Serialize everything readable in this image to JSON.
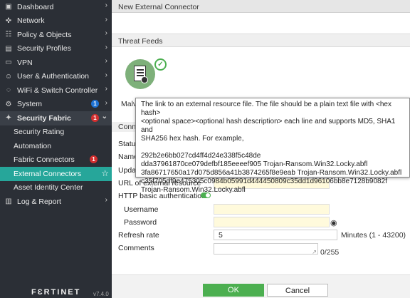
{
  "sidebar": {
    "items": [
      {
        "label": "Dashboard",
        "icon": "dashboard-icon",
        "glyph": "▣"
      },
      {
        "label": "Network",
        "icon": "network-icon",
        "glyph": "✜"
      },
      {
        "label": "Policy & Objects",
        "icon": "policy-icon",
        "glyph": "☷"
      },
      {
        "label": "Security Profiles",
        "icon": "lock-icon",
        "glyph": "▤"
      },
      {
        "label": "VPN",
        "icon": "vpn-icon",
        "glyph": "▭"
      },
      {
        "label": "User & Authentication",
        "icon": "user-icon",
        "glyph": "☺"
      },
      {
        "label": "WiFi & Switch Controller",
        "icon": "wifi-icon",
        "glyph": "◌"
      },
      {
        "label": "System",
        "icon": "gear-icon",
        "glyph": "⚙",
        "badge": "1"
      },
      {
        "label": "Security Fabric",
        "icon": "fabric-icon",
        "glyph": "✦",
        "badge": "1"
      }
    ],
    "subitems": [
      {
        "label": "Security Rating"
      },
      {
        "label": "Automation"
      },
      {
        "label": "Fabric Connectors",
        "badge": "1"
      },
      {
        "label": "External Connectors"
      },
      {
        "label": "Asset Identity Center"
      }
    ],
    "log": {
      "label": "Log & Report",
      "icon": "chart-icon",
      "glyph": "▥"
    },
    "brand": "FԐRTINET",
    "version": "v7.4.0"
  },
  "main": {
    "title": "New External Connector",
    "section": "Threat Feeds",
    "partial_malw": "Malv",
    "partial_conn": "Conne",
    "partial_status": "Status",
    "partial_name": "Name",
    "partial_update": "Updat",
    "form": {
      "url_label": "URL of external resource",
      "http_auth_label": "HTTP basic authentication",
      "username_label": "Username",
      "password_label": "Password",
      "refresh_label": "Refresh rate",
      "refresh_value": "5",
      "refresh_hint": "Minutes (1 - 43200)",
      "comments_label": "Comments",
      "comments_count": "0/255"
    },
    "buttons": {
      "ok": "OK",
      "cancel": "Cancel"
    }
  },
  "tooltip": {
    "line1": "The link to an external resource file. The file should be a plain text file with <hex hash>",
    "line2": "<optional space><optional hash description> each line and supports MD5, SHA1 and",
    "line3": "SHA256 hex hash. For example,",
    "ex1": "292b2e6bb027cd4ff4d24e338f5c48de",
    "ex2": "dda37961870ce079defbf185eeeef905 Trojan-Ransom.Win32.Locky.abfl",
    "ex3": "3fa86717650a17d075d856a41b3874265f8e9eab Trojan-Ransom.Win32.Locky.abfl",
    "ex4": "c35f705df9e475305c0984b05991d444450809c35dd1d96106bb8e7128b9082f",
    "ex5": "Trojan-Ransom.Win32.Locky.abfl"
  },
  "colors": {
    "accent": "#26a69a",
    "ok_button": "#4caf50",
    "sidebar": "#2b2f36",
    "badge_red": "#d32f2f",
    "badge_blue": "#1e73d6",
    "input_highlight": "#fffadc"
  }
}
